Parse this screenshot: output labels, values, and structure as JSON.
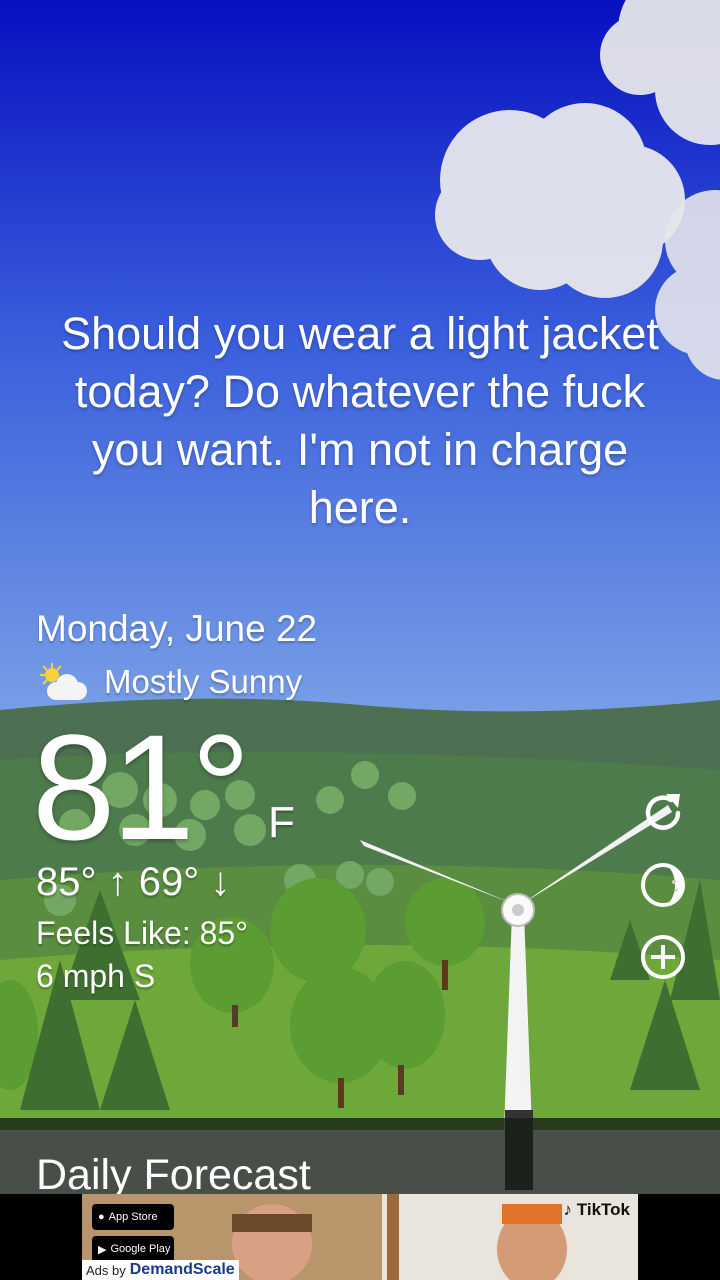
{
  "app": {
    "message": "Should you wear a light jacket today? Do whatever the fuck you want. I'm not in charge here."
  },
  "weather": {
    "date": "Monday, June 22",
    "condition": "Mostly Sunny",
    "condition_icon": "partly-sunny-icon",
    "temperature": "81°",
    "unit": "F",
    "hilo": "85° ↑  69° ↓",
    "feels_like": "Feels Like: 85°",
    "wind": "6 mph S"
  },
  "actions": {
    "refresh_icon": "refresh-icon",
    "moon_icon": "moon-phase-icon",
    "add_icon": "add-location-icon"
  },
  "forecast": {
    "title": "Daily Forecast"
  },
  "ad": {
    "app_store": "App Store",
    "google_play": "Google Play",
    "ads_by": "Ads by",
    "network": "DemandScale",
    "brand": "TikTok"
  },
  "colors": {
    "sky_top": "#0b17c4",
    "sky_bottom": "#6f9de6",
    "hill": "#4f7a55",
    "grass": "#6fa63a"
  }
}
